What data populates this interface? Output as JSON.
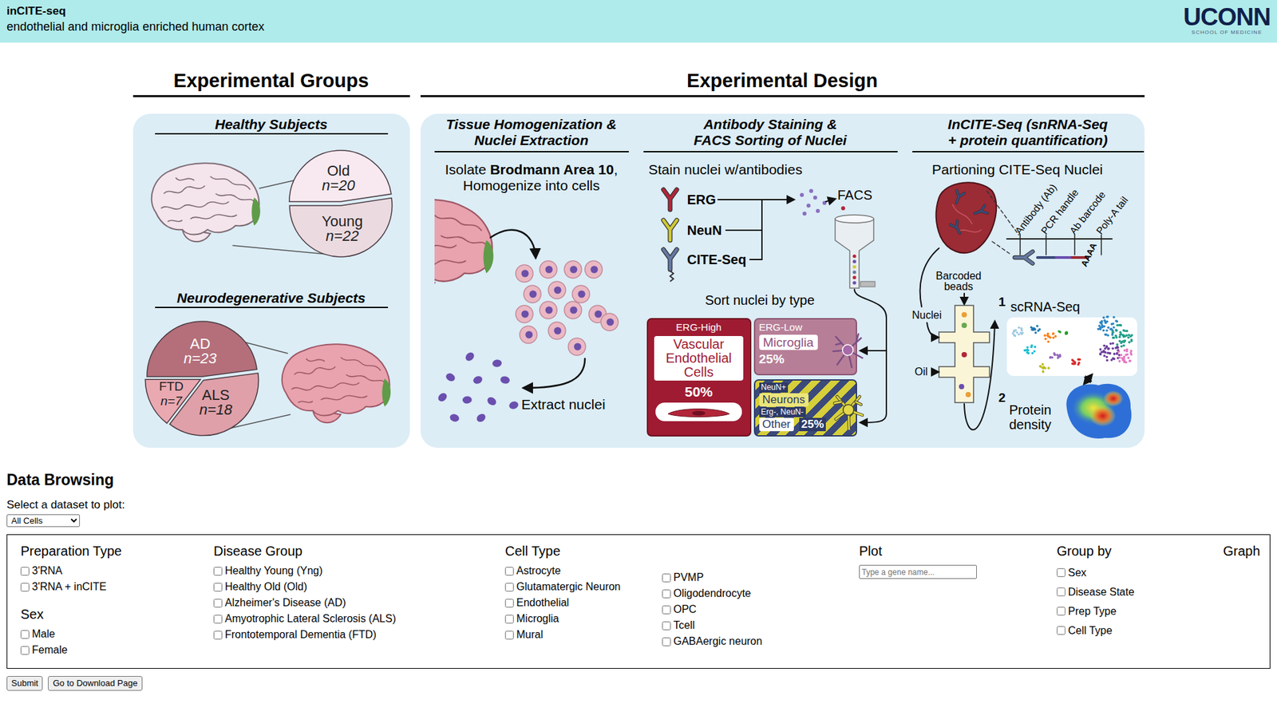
{
  "header": {
    "title": "inCITE-seq",
    "subtitle": "endothelial and microglia enriched human cortex",
    "logo": "UCONN",
    "logo_sub": "SCHOOL OF MEDICINE"
  },
  "groups": {
    "heading": "Experimental Groups",
    "healthy": {
      "title": "Healthy Subjects",
      "slices": [
        {
          "label": "Old",
          "n": "n=20",
          "value": 20,
          "color": "#f7e9ef"
        },
        {
          "label": "Young",
          "n": "n=22",
          "value": 22,
          "color": "#ebdbe1"
        }
      ]
    },
    "neuro": {
      "title": "Neurodegenerative Subjects",
      "slices": [
        {
          "label": "AD",
          "n": "n=23",
          "value": 23,
          "color": "#b46f7a"
        },
        {
          "label": "ALS",
          "n": "n=18",
          "value": 18,
          "color": "#dfa0a9"
        },
        {
          "label": "FTD",
          "n": "n=7",
          "value": 7,
          "color": "#eaa9b1"
        }
      ]
    }
  },
  "design": {
    "heading": "Experimental Design",
    "tissue": {
      "title": [
        "Tissue Homogenization &",
        "Nuclei Extraction"
      ],
      "isolate": [
        "Isolate ",
        "Brodmann Area 10",
        ","
      ],
      "homogenize": "Homogenize into cells",
      "extract": "Extract nuclei"
    },
    "staining": {
      "title": [
        "Antibody Staining &",
        "FACS Sorting of Nuclei"
      ],
      "stain": "Stain nuclei w/antibodies",
      "antibodies": [
        {
          "label": "ERG",
          "color": "#b3263a"
        },
        {
          "label": "NeuN",
          "color": "#cfc836"
        },
        {
          "label": "CITE-Seq",
          "color": "#6479a3"
        }
      ],
      "facs": "FACS",
      "sort": "Sort nuclei by type",
      "high": {
        "tag": "ERG-High",
        "name": [
          "Vascular",
          "Endothelial",
          "Cells"
        ],
        "pct": "50%"
      },
      "low": {
        "tag": "ERG-Low",
        "name": "Microglia",
        "pct": "25%"
      },
      "neun": {
        "tag": "NeuN+",
        "name": "Neurons",
        "tag2": "Erg-, NeuN-",
        "name2": "Other",
        "pct": "25%"
      }
    },
    "incite": {
      "title": [
        "InCITE-Seq (snRNA-Seq",
        "+ protein quantification)"
      ],
      "partition": "Partioning CITE-Seq Nuclei",
      "parts": [
        "Antibody (Ab)",
        "PCR handle",
        "Ab barcode",
        "Poly-A tail"
      ],
      "polya": "AAAA",
      "beads": [
        "Barcoded",
        "beads"
      ],
      "nuclei": "Nuclei",
      "oil": "Oil",
      "step1": "1",
      "rna": "scRNA-Seq",
      "step2": "2",
      "protein": [
        "Protein",
        "density"
      ]
    }
  },
  "browse": {
    "title": "Data Browsing",
    "dataset_label": "Select a dataset to plot:",
    "dataset": "All Cells",
    "prep": {
      "heading": "Preparation Type",
      "options": [
        {
          "label": "3'RNA",
          "checked": false
        },
        {
          "label": "3'RNA + inCITE",
          "checked": false
        }
      ]
    },
    "sex": {
      "heading": "Sex",
      "options": [
        {
          "label": "Male",
          "checked": false
        },
        {
          "label": "Female",
          "checked": false
        }
      ]
    },
    "disease": {
      "heading": "Disease Group",
      "options": [
        {
          "label": "Healthy Young (Yng)",
          "checked": false
        },
        {
          "label": "Healthy Old (Old)",
          "checked": false
        },
        {
          "label": "Alzheimer's Disease (AD)",
          "checked": false
        },
        {
          "label": "Amyotrophic Lateral Sclerosis (ALS)",
          "checked": false
        },
        {
          "label": "Frontotemporal Dementia (FTD)",
          "checked": false
        }
      ]
    },
    "cell_type": {
      "heading": "Cell Type",
      "columns": [
        [
          {
            "label": "Astrocyte",
            "checked": false
          },
          {
            "label": "Glutamatergic Neuron",
            "checked": false
          },
          {
            "label": "Endothelial",
            "checked": false
          },
          {
            "label": "Microglia",
            "checked": false
          },
          {
            "label": "Mural",
            "checked": false
          }
        ],
        [
          {
            "label": "PVMP",
            "checked": false
          },
          {
            "label": "Oligodendrocyte",
            "checked": false
          },
          {
            "label": "OPC",
            "checked": false
          },
          {
            "label": "Tcell",
            "checked": false
          },
          {
            "label": "GABAergic neuron",
            "checked": false
          }
        ]
      ]
    },
    "plot": {
      "heading": "Plot",
      "placeholder": "Type a gene name..."
    },
    "group_by": {
      "heading": "Group by",
      "options": [
        {
          "label": "Sex",
          "checked": false
        },
        {
          "label": "Disease State",
          "checked": false
        },
        {
          "label": "Prep Type",
          "checked": false
        },
        {
          "label": "Cell Type",
          "checked": false
        }
      ]
    },
    "graph": {
      "heading": "Graph"
    },
    "buttons": [
      "Submit",
      "Go to Download Page"
    ]
  }
}
